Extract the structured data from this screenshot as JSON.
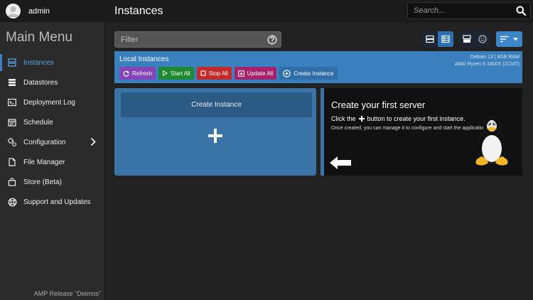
{
  "user": {
    "name": "admin"
  },
  "header": {
    "title": "Instances",
    "search_placeholder": "Search..."
  },
  "sidebar": {
    "title": "Main Menu",
    "items": [
      {
        "label": "Instances",
        "icon": "instances-icon",
        "active": true
      },
      {
        "label": "Datastores",
        "icon": "datastores-icon"
      },
      {
        "label": "Deployment Log",
        "icon": "terminal-icon"
      },
      {
        "label": "Schedule",
        "icon": "calendar-icon"
      },
      {
        "label": "Configuration",
        "icon": "gears-icon",
        "has_submenu": true
      },
      {
        "label": "File Manager",
        "icon": "file-icon"
      },
      {
        "label": "Store (Beta)",
        "icon": "shopping-bag-icon"
      },
      {
        "label": "Support and Updates",
        "icon": "lifebuoy-icon"
      }
    ],
    "release": "AMP Release \"Deimos\""
  },
  "filter": {
    "placeholder": "Filter"
  },
  "local_instances": {
    "title": "Local Instances",
    "sys_line1": "Debian  13 | 8GB RAM",
    "sys_line2": "AMD Ryzen 5 1600X (2C\\4T)",
    "actions": {
      "refresh": "Refresh",
      "start_all": "Start All",
      "stop_all": "Stop All",
      "update_all": "Update All",
      "create_instance": "Create Instance"
    }
  },
  "create_card": {
    "button_label": "Create Instance"
  },
  "hint": {
    "title": "Create your first server",
    "line1_pre": "Click the",
    "line1_post": "button to create your first instance.",
    "line2": "Once created, you can manage it to configure and start the application."
  },
  "colors": {
    "accent": "#3a7fbe",
    "card": "#3a74a7",
    "refresh": "#8545b8",
    "start": "#1f8a31",
    "stop": "#c42a2a",
    "update": "#a6236b"
  }
}
